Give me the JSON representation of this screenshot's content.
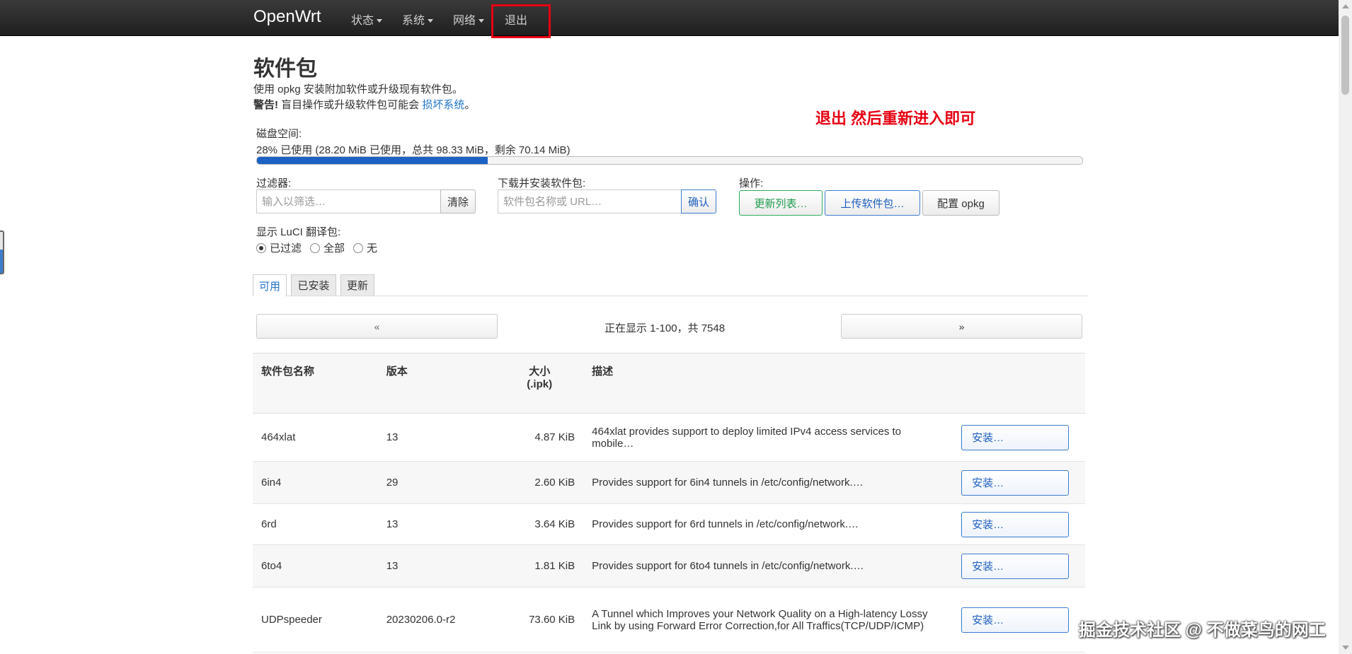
{
  "navbar": {
    "brand": "OpenWrt",
    "items": [
      {
        "label": "状态",
        "dropdown": true
      },
      {
        "label": "系统",
        "dropdown": true
      },
      {
        "label": "网络",
        "dropdown": true
      },
      {
        "label": "退出",
        "dropdown": false
      }
    ],
    "highlight_color": "#e60012"
  },
  "page": {
    "title": "软件包",
    "description": "使用 opkg 安装附加软件或升级现有软件包。",
    "warning_prefix": "警告!",
    "warning_text": " 盲目操作或升级软件包可能会 ",
    "warning_link": "损坏系统",
    "warning_suffix": "。"
  },
  "annotation": "退出 然后重新进入即可",
  "disk": {
    "label": "磁盘空间:",
    "usage_text": "28% 已使用 (28.20 MiB 已使用，总共 98.33 MiB，剩余 70.14 MiB)",
    "percent": 28
  },
  "filter": {
    "label": "过滤器:",
    "placeholder": "输入以筛选…",
    "clear_label": "清除"
  },
  "download": {
    "label": "下载并安装软件包:",
    "placeholder": "软件包名称或 URL…",
    "confirm_label": "确认"
  },
  "actions": {
    "label": "操作:",
    "update_label": "更新列表…",
    "upload_label": "上传软件包…",
    "config_label": "配置 opkg"
  },
  "translations": {
    "label": "显示 LuCI 翻译包:",
    "options": [
      "已过滤",
      "全部",
      "无"
    ],
    "selected": "已过滤"
  },
  "tabs": [
    "可用",
    "已安装",
    "更新"
  ],
  "pager": {
    "prev": "«",
    "next": "»",
    "status": "正在显示 1-100，共 7548"
  },
  "table": {
    "headers": {
      "name": "软件包名称",
      "version": "版本",
      "size_line1": "大小",
      "size_line2": "(.ipk)",
      "desc": "描述"
    },
    "install_label": "安装…",
    "rows": [
      {
        "name": "464xlat",
        "version": "13",
        "size": "4.87 KiB",
        "desc": "464xlat provides support to deploy limited IPv4 access services to mobile…"
      },
      {
        "name": "6in4",
        "version": "29",
        "size": "2.60 KiB",
        "desc": "Provides support for 6in4 tunnels in /etc/config/network.…"
      },
      {
        "name": "6rd",
        "version": "13",
        "size": "3.64 KiB",
        "desc": "Provides support for 6rd tunnels in /etc/config/network.…"
      },
      {
        "name": "6to4",
        "version": "13",
        "size": "1.81 KiB",
        "desc": "Provides support for 6to4 tunnels in /etc/config/network.…"
      },
      {
        "name": "UDPspeeder",
        "version": "20230206.0-r2",
        "size": "73.60 KiB",
        "desc": "A Tunnel which Improves your Network Quality on a High-latency Lossy Link by using Forward Error Correction,for All Traffics(TCP/UDP/ICMP)"
      }
    ]
  },
  "watermark": "掘金技术社区 @ 不做菜鸟的网工"
}
